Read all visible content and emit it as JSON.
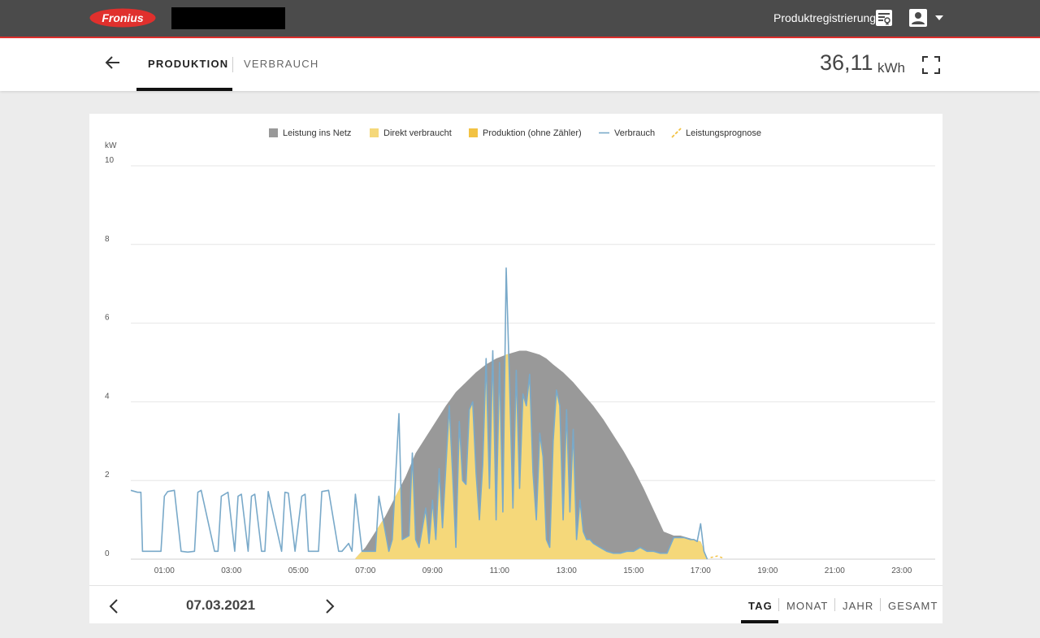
{
  "header": {
    "logo_text": "Fronius",
    "registration_label": "Produktregistrierung",
    "icons": {
      "registration": "certificate-icon",
      "user": "account-icon",
      "dropdown": "caret-down-icon"
    },
    "accent_color": "#e0302d"
  },
  "tabs": [
    {
      "label": "PRODUKTION",
      "active": true
    },
    {
      "label": "VERBRAUCH",
      "active": false
    }
  ],
  "total": {
    "value": "36,11",
    "unit": "kWh"
  },
  "chart_data": {
    "type": "area",
    "y_unit": "kW",
    "ylim": [
      0,
      10
    ],
    "y_ticks": [
      "0",
      "2",
      "4",
      "6",
      "8",
      "10"
    ],
    "x_ticks": [
      "01:00",
      "03:00",
      "05:00",
      "07:00",
      "09:00",
      "11:00",
      "13:00",
      "15:00",
      "17:00",
      "19:00",
      "21:00",
      "23:00"
    ],
    "grid": true,
    "legend_position": "top",
    "legend": [
      {
        "name": "Leistung ins Netz",
        "color": "#999999",
        "kind": "area"
      },
      {
        "name": "Direkt verbraucht",
        "color": "#f5d87a",
        "kind": "area"
      },
      {
        "name": "Produktion (ohne Zähler)",
        "color": "#f2c243",
        "kind": "area"
      },
      {
        "name": "Verbrauch",
        "color": "#79a9c9",
        "kind": "line"
      },
      {
        "name": "Leistungsprognose",
        "color": "#f2c243",
        "kind": "dashed"
      }
    ],
    "series": [
      {
        "name": "Produktion",
        "x": [
          6.7,
          7.0,
          7.3,
          7.6,
          7.9,
          8.2,
          8.5,
          8.8,
          9.1,
          9.4,
          9.7,
          10.0,
          10.3,
          10.6,
          10.9,
          11.2,
          11.4,
          11.6,
          11.8,
          12.0,
          12.2,
          12.4,
          12.6,
          12.9,
          13.2,
          13.5,
          13.8,
          14.1,
          14.4,
          14.7,
          15.0,
          15.3,
          15.6,
          15.9,
          16.2,
          16.4,
          16.6,
          16.8,
          17.0,
          17.2
        ],
        "y": [
          0.02,
          0.3,
          0.7,
          1.1,
          1.6,
          2.1,
          2.7,
          3.1,
          3.5,
          3.9,
          4.25,
          4.5,
          4.75,
          4.95,
          5.1,
          5.2,
          5.25,
          5.3,
          5.3,
          5.25,
          5.2,
          5.1,
          4.95,
          4.75,
          4.5,
          4.2,
          3.9,
          3.55,
          3.15,
          2.75,
          2.3,
          1.8,
          1.25,
          0.7,
          0.6,
          0.6,
          0.55,
          0.5,
          0.45,
          0.02
        ]
      },
      {
        "name": "Verbrauch",
        "x": [
          0.0,
          0.2,
          0.3,
          0.35,
          0.5,
          0.9,
          1.0,
          1.1,
          1.3,
          1.5,
          1.7,
          1.9,
          2.0,
          2.1,
          2.5,
          2.6,
          2.7,
          2.9,
          3.1,
          3.2,
          3.3,
          3.5,
          3.6,
          3.7,
          3.9,
          4.0,
          4.1,
          4.5,
          4.6,
          4.7,
          4.9,
          5.1,
          5.2,
          5.3,
          5.6,
          5.7,
          5.9,
          6.2,
          6.3,
          6.5,
          6.6,
          6.7,
          6.9,
          7.3,
          7.4,
          7.7,
          7.8,
          8.0,
          8.1,
          8.3,
          8.4,
          8.5,
          8.6,
          8.8,
          8.9,
          9.0,
          9.1,
          9.2,
          9.3,
          9.5,
          9.6,
          9.7,
          9.8,
          9.9,
          10.0,
          10.1,
          10.2,
          10.3,
          10.4,
          10.5,
          10.6,
          10.7,
          10.8,
          10.9,
          11.0,
          11.1,
          11.2,
          11.3,
          11.4,
          11.5,
          11.6,
          11.7,
          11.8,
          11.9,
          12.0,
          12.1,
          12.2,
          12.3,
          12.4,
          12.5,
          12.6,
          12.7,
          12.8,
          12.9,
          13.0,
          13.1,
          13.2,
          13.3,
          13.4,
          13.5,
          13.6,
          13.7,
          13.8,
          13.9,
          14.0,
          14.2,
          14.4,
          14.6,
          14.8,
          15.0,
          15.2,
          15.4,
          15.6,
          15.8,
          16.0,
          16.2,
          16.5,
          16.7,
          16.8,
          16.9,
          17.0,
          17.1,
          17.2
        ],
        "y": [
          1.75,
          1.7,
          1.7,
          0.2,
          0.2,
          0.2,
          1.6,
          1.72,
          1.75,
          0.2,
          0.18,
          0.2,
          1.7,
          1.75,
          0.2,
          0.2,
          1.6,
          1.7,
          0.2,
          1.6,
          1.65,
          0.2,
          1.6,
          1.65,
          0.2,
          0.2,
          1.72,
          0.2,
          1.7,
          1.68,
          0.2,
          1.6,
          1.65,
          0.2,
          0.2,
          1.72,
          1.75,
          0.2,
          0.2,
          0.4,
          0.2,
          1.65,
          0.2,
          0.2,
          1.6,
          0.2,
          0.5,
          3.7,
          0.5,
          0.6,
          2.7,
          0.5,
          0.3,
          1.3,
          0.4,
          1.5,
          0.5,
          2.3,
          0.8,
          3.9,
          2.2,
          0.3,
          3.5,
          2.0,
          1.9,
          3.8,
          4.0,
          2.2,
          1.0,
          2.4,
          5.1,
          1.8,
          5.3,
          1.0,
          5.0,
          1.2,
          7.4,
          4.5,
          1.3,
          4.8,
          1.8,
          4.2,
          3.9,
          4.7,
          2.2,
          1.0,
          3.2,
          2.6,
          0.5,
          0.3,
          3.0,
          4.3,
          3.9,
          1.0,
          3.8,
          1.2,
          3.3,
          0.5,
          1.5,
          0.7,
          0.5,
          0.5,
          0.4,
          0.35,
          0.3,
          0.2,
          0.15,
          0.15,
          0.2,
          0.2,
          0.3,
          0.2,
          0.2,
          0.15,
          0.15,
          0.55,
          0.55,
          0.5,
          0.5,
          0.45,
          0.9,
          0.2,
          0.0
        ]
      },
      {
        "name": "Leistungsprognose",
        "x": [
          17.3,
          17.5,
          17.7
        ],
        "y": [
          0.04,
          0.08,
          0.02
        ]
      }
    ]
  },
  "footer": {
    "date": "07.03.2021",
    "range_tabs": [
      {
        "label": "TAG",
        "active": true
      },
      {
        "label": "MONAT",
        "active": false
      },
      {
        "label": "JAHR",
        "active": false
      },
      {
        "label": "GESAMT",
        "active": false
      }
    ]
  }
}
